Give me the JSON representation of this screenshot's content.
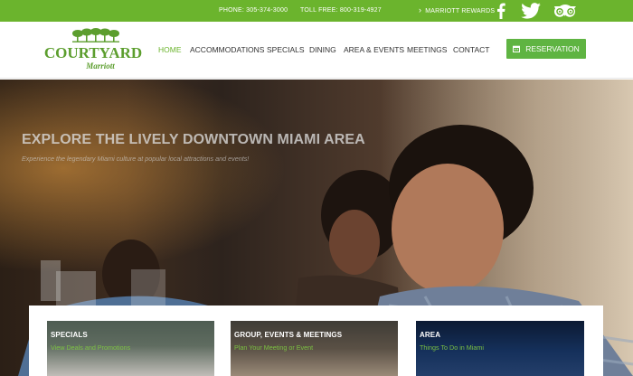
{
  "topbar": {
    "phone": "PHONE: 305-374-3000",
    "toll_free": "TOLL FREE: 800-319-4927",
    "rewards": "MARRIOTT REWARDS",
    "social": [
      "facebook-icon",
      "twitter-icon",
      "tripadvisor-icon"
    ]
  },
  "logo": {
    "brand": "COURTYARD",
    "sub": "Marriott"
  },
  "nav": {
    "items": [
      "HOME",
      "ACCOMMODATIONS",
      "SPECIALS",
      "DINING",
      "AREA & EVENTS",
      "MEETINGS",
      "CONTACT"
    ],
    "active": "HOME"
  },
  "reservation": {
    "label": "RESERVATION"
  },
  "hero": {
    "title": "EXPLORE THE LIVELY DOWNTOWN MIAMI AREA",
    "subtitle": "Experience the legendary Miami culture at popular local attractions and events!"
  },
  "cards": [
    {
      "title": "SPECIALS",
      "link": "View Deals and Promotions"
    },
    {
      "title": "GROUP, EVENTS & MEETINGS",
      "link": "Plan Your Meeting or Event"
    },
    {
      "title": "AREA",
      "link": "Things To Do in Miami"
    }
  ],
  "colors": {
    "brand_green": "#6bb42d",
    "button_green": "#5fb442",
    "link_green": "#7bc142"
  }
}
